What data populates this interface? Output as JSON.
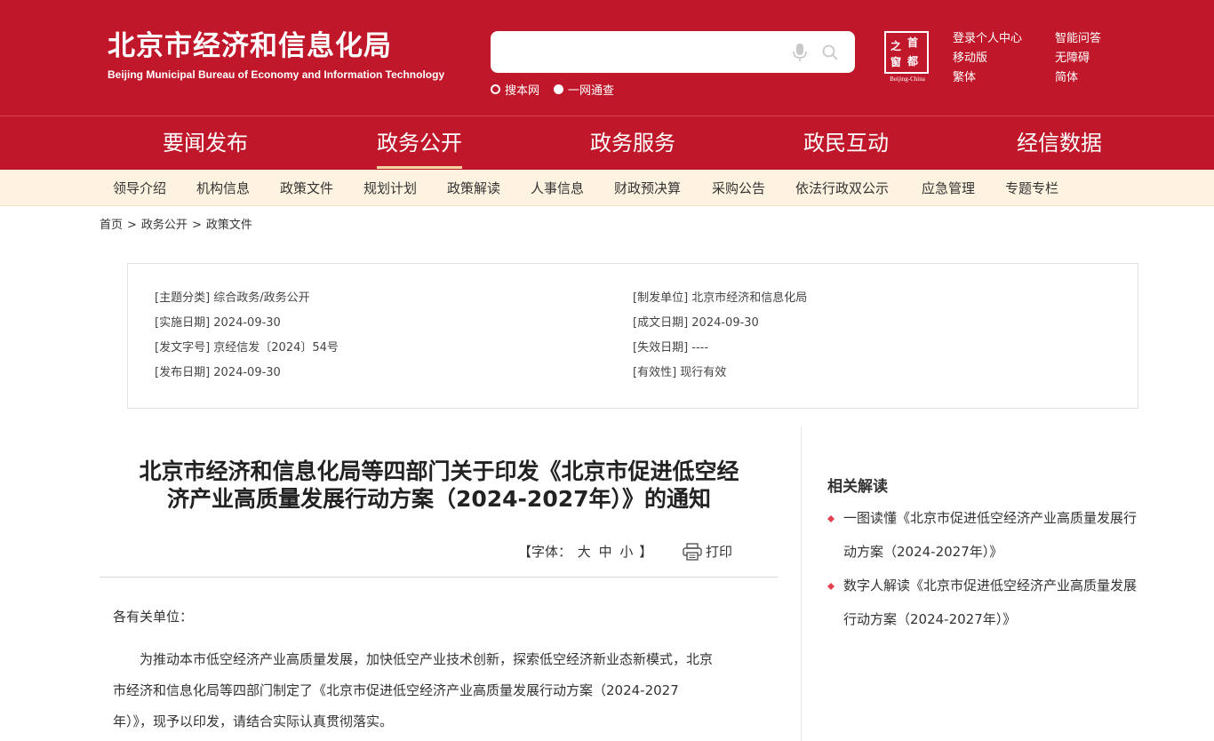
{
  "header": {
    "title_cn": "北京市经济和信息化局",
    "title_en": "Beijing Municipal Bureau of Economy and Information Technology",
    "search": {
      "placeholder": "",
      "value": ""
    },
    "radio_options": [
      {
        "label": "搜本网",
        "selected": false
      },
      {
        "label": "一网通查",
        "selected": true
      }
    ],
    "seal": {
      "chars": [
        "首",
        "都",
        "之",
        "窗"
      ],
      "caption": "Beijing-China"
    },
    "top_links": [
      "登录个人中心",
      "移动版",
      "繁体",
      "智能问答",
      "无障碍",
      "简体"
    ]
  },
  "main_nav": {
    "items": [
      "要闻发布",
      "政务公开",
      "政务服务",
      "政民互动",
      "经信数据"
    ],
    "active": "政务公开"
  },
  "sub_nav": {
    "items": [
      "领导介绍",
      "机构信息",
      "政策文件",
      "规划计划",
      "政策解读",
      "人事信息",
      "财政预决算",
      "采购公告",
      "依法行政双公示",
      "应急管理",
      "专题专栏"
    ]
  },
  "breadcrumb": {
    "items": [
      "首页",
      "政务公开",
      "政策文件"
    ],
    "separator": ">"
  },
  "info": {
    "left": [
      "[主题分类] 综合政务/政务公开",
      "[实施日期] 2024-09-30",
      "[发文字号] 京经信发〔2024〕54号",
      "[发布日期] 2024-09-30"
    ],
    "right": [
      "[制发单位] 北京市经济和信息化局",
      "[成文日期] 2024-09-30",
      "[失效日期] ----",
      "[有效性] 现行有效"
    ]
  },
  "article": {
    "title_lines": [
      "北京市经济和信息化局等四部门关于印发《北京市促进低空经",
      "济产业高质量发展行动方案（2024-2027年）》的通知"
    ],
    "font_label_open": "【字体：",
    "font_sizes": [
      "大",
      "中",
      "小"
    ],
    "font_label_close": "】",
    "print_label": "打印",
    "salutation": "各有关单位：",
    "body_lines": [
      "　　为推动本市低空经济产业高质量发展，加快低空产业技术创新，探索低空经济新业态新模式，北京",
      "市经济和信息化局等四部门制定了《北京市促进低空经济产业高质量发展行动方案（2024-2027",
      "年）》，现予以印发，请结合实际认真贯彻落实。"
    ]
  },
  "sidebar": {
    "title": "相关解读",
    "items": [
      {
        "lines": [
          "一图读懂《北京市促进低空经济产业高质量发展行",
          "动方案（2024-2027年）》"
        ]
      },
      {
        "lines": [
          "数字人解读《北京市促进低空经济产业高质量发展",
          "行动方案（2024-2027年）》"
        ]
      }
    ]
  },
  "colors": {
    "brand_red": "#c0182a",
    "subnav_bg": "#fdf3e0",
    "active_underline": "#f7d6a2",
    "bullet_red": "#e0404e"
  },
  "icons": [
    "microphone-icon",
    "search-icon",
    "printer-icon",
    "red-bullet-icon"
  ]
}
